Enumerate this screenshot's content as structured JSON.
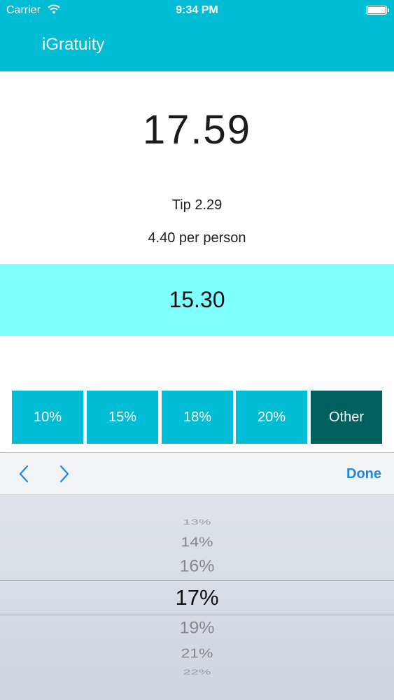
{
  "status_bar": {
    "carrier": "Carrier",
    "time": "9:34 PM"
  },
  "nav": {
    "title": "iGratuity"
  },
  "result": {
    "total": "17.59",
    "tip": "Tip 2.29",
    "per_person": "4.40 per person"
  },
  "bill": {
    "amount": "15.30"
  },
  "percent_buttons": [
    "10%",
    "15%",
    "18%",
    "20%",
    "Other"
  ],
  "selected_button": "Other",
  "toolbar": {
    "done_label": "Done",
    "prev_icon": "chevron-left-icon",
    "next_icon": "chevron-right-icon"
  },
  "picker": {
    "rows": [
      "13%",
      "14%",
      "16%",
      "17%",
      "19%",
      "21%",
      "22%"
    ],
    "selected": "17%"
  },
  "colors": {
    "accent": "#00bcd4",
    "bill_bg": "#80ffff",
    "selected_button": "#00605e",
    "done": "#1e88e5"
  }
}
